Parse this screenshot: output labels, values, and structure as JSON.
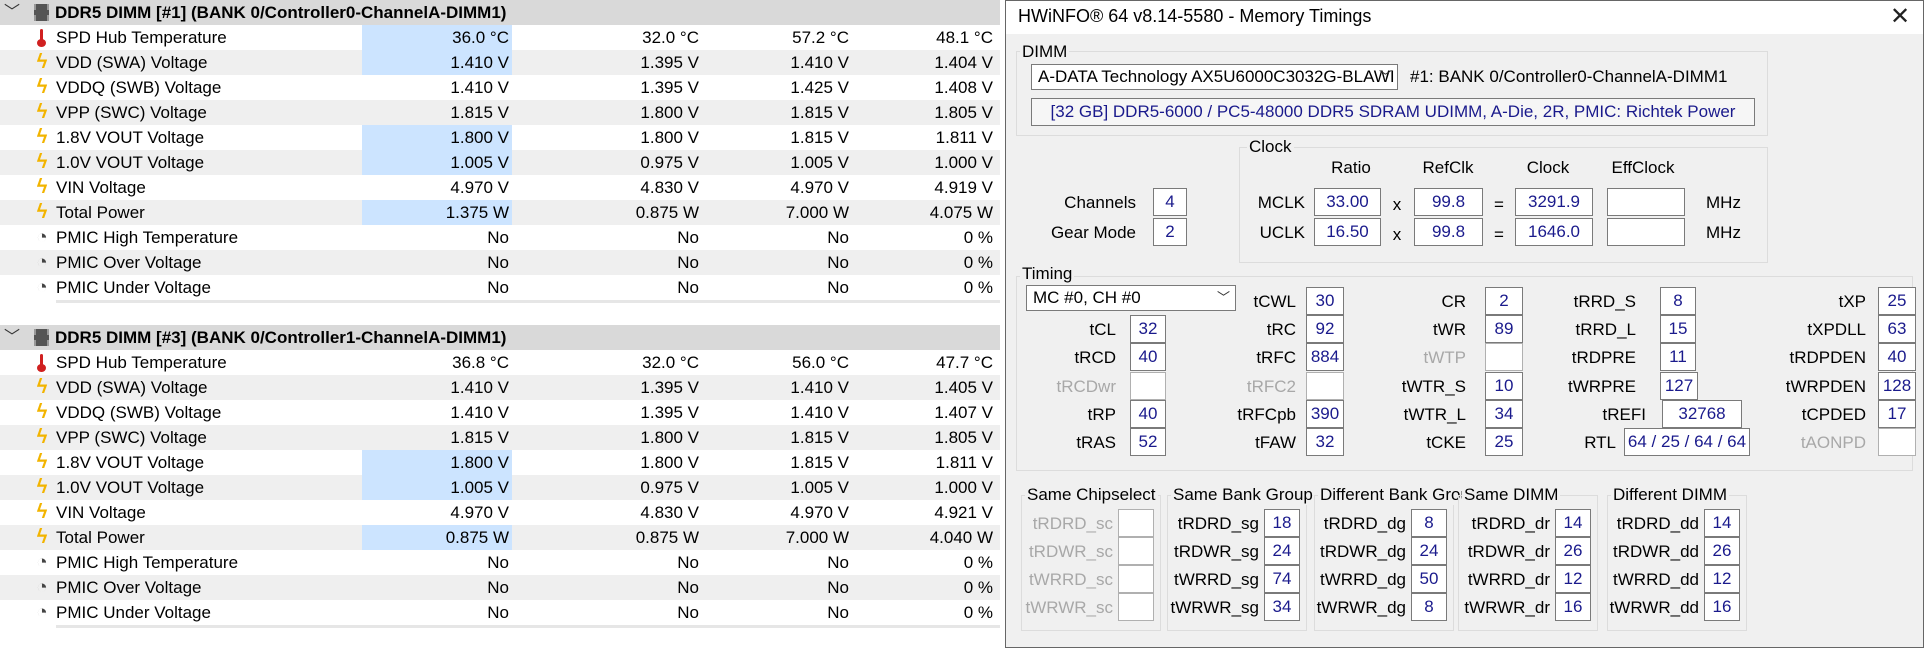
{
  "groups": [
    {
      "title": "DDR5 DIMM [#1] (BANK 0/Controller0-ChannelA-DIMM1)",
      "rows": [
        {
          "icon": "temperature-icon",
          "name": "SPD Hub Temperature",
          "cur": "36.0 °C",
          "min": "32.0 °C",
          "max": "57.2 °C",
          "avg": "48.1 °C",
          "hl": true
        },
        {
          "icon": "voltage-icon",
          "name": "VDD (SWA) Voltage",
          "cur": "1.410 V",
          "min": "1.395 V",
          "max": "1.410 V",
          "avg": "1.404 V",
          "hl": true
        },
        {
          "icon": "voltage-icon",
          "name": "VDDQ (SWB) Voltage",
          "cur": "1.410 V",
          "min": "1.395 V",
          "max": "1.425 V",
          "avg": "1.408 V",
          "hl": false
        },
        {
          "icon": "voltage-icon",
          "name": "VPP (SWC) Voltage",
          "cur": "1.815 V",
          "min": "1.800 V",
          "max": "1.815 V",
          "avg": "1.805 V",
          "hl": false
        },
        {
          "icon": "voltage-icon",
          "name": "1.8V VOUT Voltage",
          "cur": "1.800 V",
          "min": "1.800 V",
          "max": "1.815 V",
          "avg": "1.811 V",
          "hl": true
        },
        {
          "icon": "voltage-icon",
          "name": "1.0V VOUT Voltage",
          "cur": "1.005 V",
          "min": "0.975 V",
          "max": "1.005 V",
          "avg": "1.000 V",
          "hl": true
        },
        {
          "icon": "voltage-icon",
          "name": "VIN Voltage",
          "cur": "4.970 V",
          "min": "4.830 V",
          "max": "4.970 V",
          "avg": "4.919 V",
          "hl": false
        },
        {
          "icon": "voltage-icon",
          "name": "Total Power",
          "cur": "1.375 W",
          "min": "0.875 W",
          "max": "7.000 W",
          "avg": "4.075 W",
          "hl": true
        },
        {
          "icon": "status-icon",
          "name": "PMIC High Temperature",
          "cur": "No",
          "min": "No",
          "max": "No",
          "avg": "0 %",
          "hl": false
        },
        {
          "icon": "status-icon",
          "name": "PMIC Over Voltage",
          "cur": "No",
          "min": "No",
          "max": "No",
          "avg": "0 %",
          "hl": false
        },
        {
          "icon": "status-icon",
          "name": "PMIC Under Voltage",
          "cur": "No",
          "min": "No",
          "max": "No",
          "avg": "0 %",
          "hl": false
        }
      ]
    },
    {
      "title": "DDR5 DIMM [#3] (BANK 0/Controller1-ChannelA-DIMM1)",
      "rows": [
        {
          "icon": "temperature-icon",
          "name": "SPD Hub Temperature",
          "cur": "36.8 °C",
          "min": "32.0 °C",
          "max": "56.0 °C",
          "avg": "47.7 °C",
          "hl": false
        },
        {
          "icon": "voltage-icon",
          "name": "VDD (SWA) Voltage",
          "cur": "1.410 V",
          "min": "1.395 V",
          "max": "1.410 V",
          "avg": "1.405 V",
          "hl": false
        },
        {
          "icon": "voltage-icon",
          "name": "VDDQ (SWB) Voltage",
          "cur": "1.410 V",
          "min": "1.395 V",
          "max": "1.410 V",
          "avg": "1.407 V",
          "hl": false
        },
        {
          "icon": "voltage-icon",
          "name": "VPP (SWC) Voltage",
          "cur": "1.815 V",
          "min": "1.800 V",
          "max": "1.815 V",
          "avg": "1.805 V",
          "hl": false
        },
        {
          "icon": "voltage-icon",
          "name": "1.8V VOUT Voltage",
          "cur": "1.800 V",
          "min": "1.800 V",
          "max": "1.815 V",
          "avg": "1.811 V",
          "hl": true
        },
        {
          "icon": "voltage-icon",
          "name": "1.0V VOUT Voltage",
          "cur": "1.005 V",
          "min": "0.975 V",
          "max": "1.005 V",
          "avg": "1.000 V",
          "hl": true
        },
        {
          "icon": "voltage-icon",
          "name": "VIN Voltage",
          "cur": "4.970 V",
          "min": "4.830 V",
          "max": "4.970 V",
          "avg": "4.921 V",
          "hl": false
        },
        {
          "icon": "voltage-icon",
          "name": "Total Power",
          "cur": "0.875 W",
          "min": "0.875 W",
          "max": "7.000 W",
          "avg": "4.040 W",
          "hl": true
        },
        {
          "icon": "status-icon",
          "name": "PMIC High Temperature",
          "cur": "No",
          "min": "No",
          "max": "No",
          "avg": "0 %",
          "hl": false
        },
        {
          "icon": "status-icon",
          "name": "PMIC Over Voltage",
          "cur": "No",
          "min": "No",
          "max": "No",
          "avg": "0 %",
          "hl": false
        },
        {
          "icon": "status-icon",
          "name": "PMIC Under Voltage",
          "cur": "No",
          "min": "No",
          "max": "No",
          "avg": "0 %",
          "hl": false
        }
      ]
    }
  ],
  "window": {
    "title": "HWiNFO® 64 v8.14-5580 - Memory Timings",
    "close_icon": "close-icon",
    "dimm": {
      "label": "DIMM",
      "selected_module": "A-DATA Technology AX5U6000C3032G-BLAWI",
      "slot_text": "#1: BANK 0/Controller0-ChannelA-DIMM1",
      "info": "[32 GB] DDR5-6000 / PC5-48000 DDR5 SDRAM UDIMM, A-Die, 2R, PMIC: Richtek Power"
    },
    "clock": {
      "label": "Clock",
      "headers": {
        "ratio": "Ratio",
        "refclk": "RefClk",
        "clock": "Clock",
        "effclock": "EffClock"
      },
      "channels_label": "Channels",
      "channels": "4",
      "gear_label": "Gear Mode",
      "gear": "2",
      "mclk_label": "MCLK",
      "mclk_ratio": "33.00",
      "mclk_ref": "99.8",
      "mclk_clock": "3291.9",
      "mclk_eff": "",
      "uclk_label": "UCLK",
      "uclk_ratio": "16.50",
      "uclk_ref": "99.8",
      "uclk_clock": "1646.0",
      "uclk_eff": "",
      "times": "x",
      "equals": "=",
      "unit": "MHz"
    },
    "timing": {
      "label": "Timing",
      "mc_select": "MC #0, CH #0",
      "params": [
        {
          "name": "tCL",
          "value": "32",
          "enabled": true
        },
        {
          "name": "tRCD",
          "value": "40",
          "enabled": true
        },
        {
          "name": "tRCDwr",
          "value": "",
          "enabled": false
        },
        {
          "name": "tRP",
          "value": "40",
          "enabled": true
        },
        {
          "name": "tRAS",
          "value": "52",
          "enabled": true
        },
        {
          "name": "tCWL",
          "value": "30",
          "enabled": true
        },
        {
          "name": "tRC",
          "value": "92",
          "enabled": true
        },
        {
          "name": "tRFC",
          "value": "884",
          "enabled": true
        },
        {
          "name": "tRFC2",
          "value": "",
          "enabled": false
        },
        {
          "name": "tRFCpb",
          "value": "390",
          "enabled": true
        },
        {
          "name": "tFAW",
          "value": "32",
          "enabled": true
        },
        {
          "name": "CR",
          "value": "2",
          "enabled": true
        },
        {
          "name": "tWR",
          "value": "89",
          "enabled": true
        },
        {
          "name": "tWTP",
          "value": "",
          "enabled": false
        },
        {
          "name": "tWTR_S",
          "value": "10",
          "enabled": true
        },
        {
          "name": "tWTR_L",
          "value": "34",
          "enabled": true
        },
        {
          "name": "tCKE",
          "value": "25",
          "enabled": true
        },
        {
          "name": "tRRD_S",
          "value": "8",
          "enabled": true
        },
        {
          "name": "tRRD_L",
          "value": "15",
          "enabled": true
        },
        {
          "name": "tRDPRE",
          "value": "11",
          "enabled": true
        },
        {
          "name": "tWRPRE",
          "value": "127",
          "enabled": true
        },
        {
          "name": "tREFI",
          "value": "32768",
          "enabled": true
        },
        {
          "name": "RTL",
          "value": "64 / 25 / 64 / 64",
          "enabled": true
        },
        {
          "name": "tXP",
          "value": "25",
          "enabled": true
        },
        {
          "name": "tXPDLL",
          "value": "63",
          "enabled": true
        },
        {
          "name": "tRDPDEN",
          "value": "40",
          "enabled": true
        },
        {
          "name": "tWRPDEN",
          "value": "128",
          "enabled": true
        },
        {
          "name": "tCPDED",
          "value": "17",
          "enabled": true
        },
        {
          "name": "tAONPD",
          "value": "",
          "enabled": false
        }
      ]
    },
    "turnaround": [
      {
        "label": "Same Chipselect",
        "rows": [
          {
            "name": "tRDRD_sc",
            "value": "",
            "enabled": false
          },
          {
            "name": "tRDWR_sc",
            "value": "",
            "enabled": false
          },
          {
            "name": "tWRRD_sc",
            "value": "",
            "enabled": false
          },
          {
            "name": "tWRWR_sc",
            "value": "",
            "enabled": false
          }
        ]
      },
      {
        "label": "Same Bank Group",
        "rows": [
          {
            "name": "tRDRD_sg",
            "value": "18",
            "enabled": true
          },
          {
            "name": "tRDWR_sg",
            "value": "24",
            "enabled": true
          },
          {
            "name": "tWRRD_sg",
            "value": "74",
            "enabled": true
          },
          {
            "name": "tWRWR_sg",
            "value": "34",
            "enabled": true
          }
        ]
      },
      {
        "label": "Different Bank Group",
        "rows": [
          {
            "name": "tRDRD_dg",
            "value": "8",
            "enabled": true
          },
          {
            "name": "tRDWR_dg",
            "value": "24",
            "enabled": true
          },
          {
            "name": "tWRRD_dg",
            "value": "50",
            "enabled": true
          },
          {
            "name": "tWRWR_dg",
            "value": "8",
            "enabled": true
          }
        ]
      },
      {
        "label": "Same DIMM",
        "rows": [
          {
            "name": "tRDRD_dr",
            "value": "14",
            "enabled": true
          },
          {
            "name": "tRDWR_dr",
            "value": "26",
            "enabled": true
          },
          {
            "name": "tWRRD_dr",
            "value": "12",
            "enabled": true
          },
          {
            "name": "tWRWR_dr",
            "value": "16",
            "enabled": true
          }
        ]
      },
      {
        "label": "Different DIMM",
        "rows": [
          {
            "name": "tRDRD_dd",
            "value": "14",
            "enabled": true
          },
          {
            "name": "tRDWR_dd",
            "value": "26",
            "enabled": true
          },
          {
            "name": "tWRRD_dd",
            "value": "12",
            "enabled": true
          },
          {
            "name": "tWRWR_dd",
            "value": "16",
            "enabled": true
          }
        ]
      }
    ]
  }
}
